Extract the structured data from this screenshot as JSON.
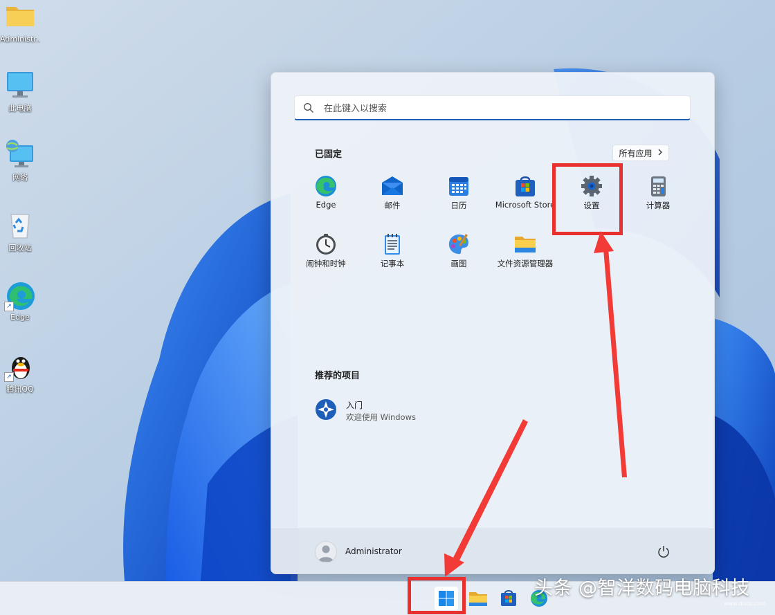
{
  "desktop": {
    "icons": [
      {
        "label": "Administr..."
      },
      {
        "label": "此电脑"
      },
      {
        "label": "网络"
      },
      {
        "label": "回收站"
      },
      {
        "label": "Edge"
      },
      {
        "label": "腾讯QQ"
      }
    ]
  },
  "start_menu": {
    "search": {
      "placeholder": "在此键入以搜索"
    },
    "pinned": {
      "title": "已固定",
      "all_apps_label": "所有应用",
      "apps": [
        {
          "name": "Edge",
          "icon": "edge-icon"
        },
        {
          "name": "邮件",
          "icon": "mail-icon"
        },
        {
          "name": "日历",
          "icon": "calendar-icon"
        },
        {
          "name": "Microsoft Store",
          "icon": "store-icon"
        },
        {
          "name": "设置",
          "icon": "gear-icon"
        },
        {
          "name": "计算器",
          "icon": "calculator-icon"
        },
        {
          "name": "闹钟和时钟",
          "icon": "clock-icon"
        },
        {
          "name": "记事本",
          "icon": "notepad-icon"
        },
        {
          "name": "画图",
          "icon": "paint-icon"
        },
        {
          "name": "文件资源管理器",
          "icon": "folder-icon"
        }
      ]
    },
    "recommended": {
      "title": "推荐的项目",
      "items": [
        {
          "title": "入门",
          "subtitle": "欢迎使用 Windows"
        }
      ]
    },
    "user": {
      "name": "Administrator"
    }
  },
  "watermark": {
    "text": "头条 @智洋数码电脑科技",
    "sub": "www.dnzp.com"
  },
  "colors": {
    "accent": "#1a5fb4",
    "highlight": "#e8302e"
  }
}
